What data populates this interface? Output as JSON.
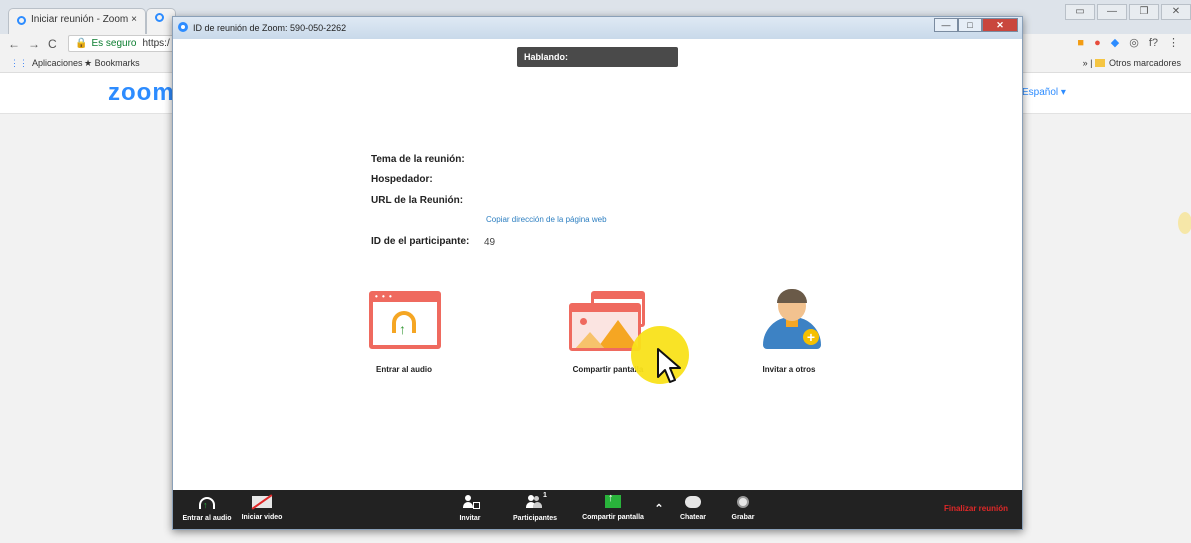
{
  "browser": {
    "tab_title": "Iniciar reunión - Zoom",
    "tab_close": "×",
    "security_label": "Es seguro",
    "url_text": "https:/",
    "bookmarks": {
      "apps": "Aplicaciones",
      "bookmarks": "Bookmarks",
      "other": "Otros marcadores"
    },
    "site_logo": "zoom",
    "language": "Español ▾"
  },
  "zoom_window": {
    "title": "ID de reunión de Zoom: 590-050-2262",
    "speaking_label": "Hablando:",
    "info": {
      "topic_label": "Tema de la reunión:",
      "host_label": "Hospedador:",
      "url_label": "URL de la Reunión:",
      "copy_link": "Copiar dirección de la página web",
      "participant_id_label": "ID de el participante:",
      "participant_id_value": "49"
    },
    "actions": [
      {
        "label": "Entrar al audio",
        "icon": "headphones-icon"
      },
      {
        "label": "Compartir pantalla",
        "icon": "share-screen-icon"
      },
      {
        "label": "Invitar a otros",
        "icon": "invite-user-icon"
      }
    ],
    "toolbar": {
      "audio": "Entrar al audio",
      "video": "Iniciar video",
      "invite": "Invitar",
      "participants": "Participantes",
      "participants_count": "1",
      "share": "Compartir pantalla",
      "chat": "Chatear",
      "record": "Grabar",
      "end": "Finalizar reunión"
    }
  },
  "colors": {
    "zoom_blue": "#2d8cff",
    "accent_red": "#ef6a5f",
    "accent_orange": "#f5a623",
    "toolbar_bg": "#222222",
    "end_red": "#e02828",
    "share_green": "#29b33b"
  }
}
